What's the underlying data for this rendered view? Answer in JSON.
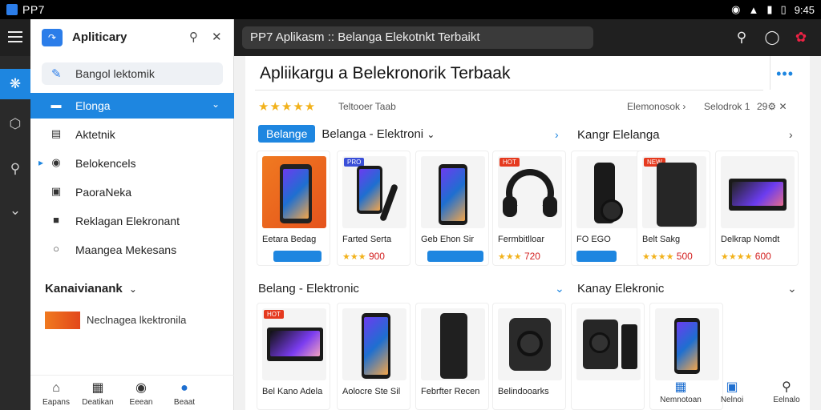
{
  "statusbar": {
    "app_name": "PP7",
    "time": "9:45"
  },
  "topbar": {
    "search_text": "PP7 Aplikasm :: Belanga Elekotnkt Terbaikt"
  },
  "drawer": {
    "title": "Apliticary",
    "search_text": "Bangol lektomik",
    "nav": [
      {
        "label": "Elonga"
      },
      {
        "label": "Aktetnik"
      },
      {
        "label": "Belokencels"
      },
      {
        "label": "PaoraNeka"
      },
      {
        "label": "Reklagan Elekronant"
      },
      {
        "label": "Maangea Mekesans"
      }
    ],
    "section_title": "Kanaivianank",
    "promo_text": "Neclnagea lkektronila",
    "bottom_nav": [
      {
        "label": "Eapans"
      },
      {
        "label": "Deatikan"
      },
      {
        "label": "Eeean"
      },
      {
        "label": "Beaat"
      }
    ]
  },
  "main": {
    "title": "Apliikargu a Belekronorik Terbaak",
    "rating_text": "Teltooer Taab",
    "filters": [
      "Elemonosok",
      "Selodrok 1",
      "29"
    ],
    "sections": [
      {
        "pill": "Belange",
        "title": "Belanga - Elektroni"
      },
      {
        "title": "Kangr Elelanga"
      },
      {
        "title": "Belang - Elektronic"
      },
      {
        "title": "Kanay Elekronic"
      }
    ],
    "row1": [
      {
        "name": "Eetara Bedag",
        "price": ""
      },
      {
        "name": "Farted Serta",
        "price": "900"
      },
      {
        "name": "Geb Ehon Sir",
        "price": ""
      },
      {
        "name": "Fermbitlloar",
        "price": "720"
      },
      {
        "name": "FO EGO",
        "price": ""
      },
      {
        "name": "Belt Sakg",
        "price": "500"
      },
      {
        "name": "Delkrap Nomdt",
        "price": "600"
      }
    ],
    "row2": [
      {
        "name": "Bel Kano Adela",
        "price": ""
      },
      {
        "name": "Aolocre Ste Sil",
        "price": ""
      },
      {
        "name": "Febrfter Recen",
        "price": ""
      },
      {
        "name": "Belindooarks",
        "price": ""
      }
    ],
    "bottom_nav": [
      {
        "label": "Nemnotoan"
      },
      {
        "label": "Nelnoi"
      },
      {
        "label": "Eelnalo"
      }
    ]
  },
  "colors": {
    "accent": "#1e86e0",
    "star": "#f2b21c",
    "price": "#d32020"
  }
}
